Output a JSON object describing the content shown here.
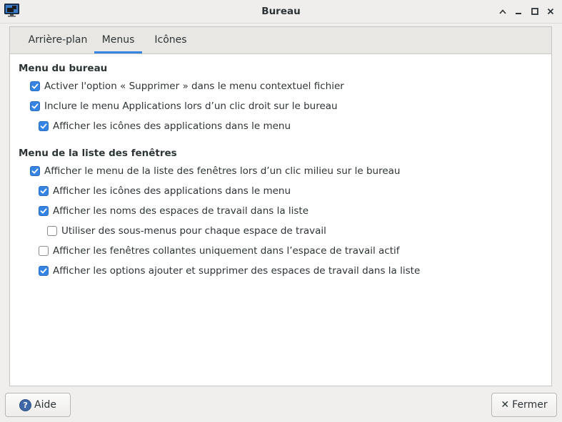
{
  "window": {
    "title": "Bureau",
    "controls": {
      "shade": "^",
      "minimize": "‒",
      "maximize": "□",
      "close": "✕"
    }
  },
  "tabs": [
    {
      "label": "Arrière-plan",
      "active": false
    },
    {
      "label": "Menus",
      "active": true
    },
    {
      "label": "Icônes",
      "active": false
    }
  ],
  "sections": [
    {
      "title": "Menu du bureau",
      "options": [
        {
          "label": "Activer l'option « Supprimer » dans le menu contextuel fichier",
          "checked": true
        },
        {
          "label": "Inclure le menu Applications lors d’un clic droit sur le bureau",
          "checked": true
        },
        {
          "label": "Afficher les icônes des applications dans le menu",
          "checked": true
        }
      ]
    },
    {
      "title": "Menu de la liste des fenêtres",
      "options": [
        {
          "label": "Afficher le menu de la liste des fenêtres lors d’un clic milieu sur le bureau",
          "checked": true
        },
        {
          "label": "Afficher les icônes des applications dans le menu",
          "checked": true
        },
        {
          "label": "Afficher les noms des espaces de travail dans la liste",
          "checked": true
        },
        {
          "label": "Utiliser des sous-menus pour chaque espace de travail",
          "checked": false
        },
        {
          "label": "Afficher les fenêtres collantes uniquement dans l’espace de travail actif",
          "checked": false
        },
        {
          "label": "Afficher les options ajouter et supprimer des espaces de travail dans la liste",
          "checked": true
        }
      ]
    }
  ],
  "buttons": {
    "help_label": "Aide",
    "help_glyph": "?",
    "close_label": "Fermer",
    "close_glyph": "✕"
  },
  "colors": {
    "accent": "#3584e4"
  }
}
